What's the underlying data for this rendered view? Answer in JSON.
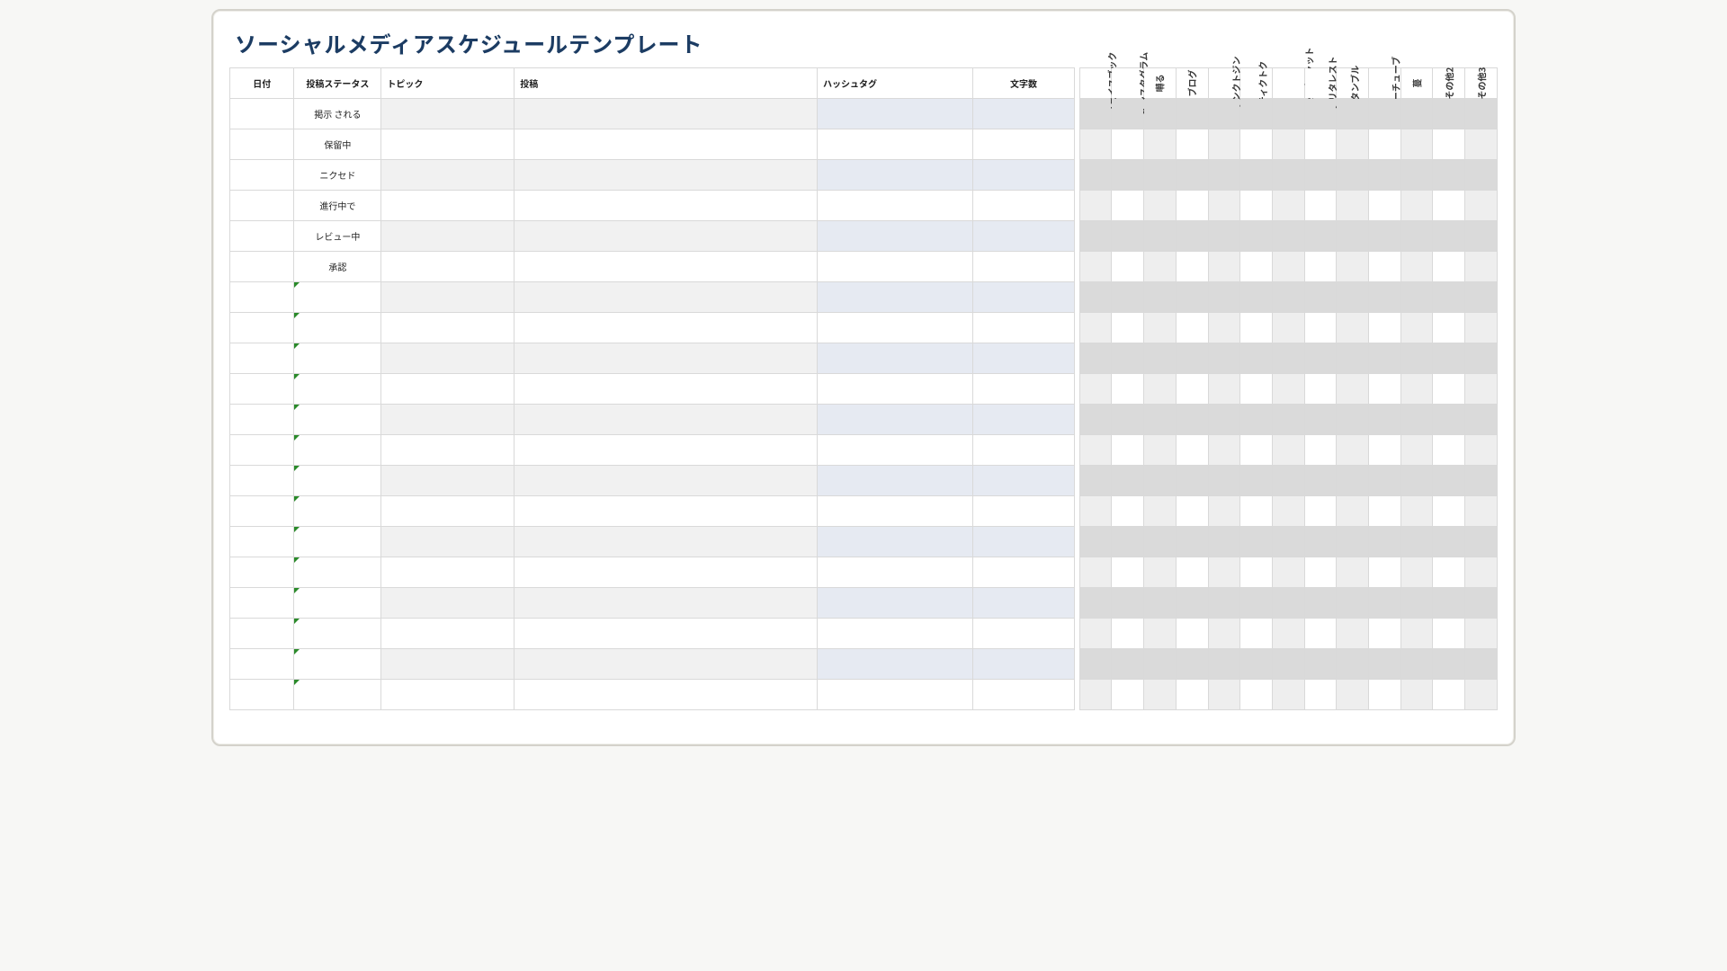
{
  "title": "ソーシャルメディアスケジュールテンプレート",
  "headers_main": {
    "date": "日付",
    "status": "投稿ステータス",
    "topic": "トピック",
    "post": "投稿",
    "hashtag": "ハッシュタグ",
    "chars": "文字数"
  },
  "platforms": [
    "フェイスブック",
    "インスタグラム",
    "囀る",
    "ブログ",
    "リンクトジン",
    "ティクトク",
    "スナップチャット",
    "プリタレスト",
    "タンブル",
    "ユーチューブ",
    "蔓",
    "その他2",
    "その他3"
  ],
  "rows": [
    {
      "status": "掲示 される",
      "band": "A",
      "marker": false
    },
    {
      "status": "保留中",
      "band": "B",
      "marker": false
    },
    {
      "status": "ニクセド",
      "band": "A",
      "marker": false
    },
    {
      "status": "進行中で",
      "band": "B",
      "marker": false
    },
    {
      "status": "レビュー中",
      "band": "A",
      "marker": false
    },
    {
      "status": "承認",
      "band": "B",
      "marker": false
    },
    {
      "status": "",
      "band": "A",
      "marker": true
    },
    {
      "status": "",
      "band": "B",
      "marker": true
    },
    {
      "status": "",
      "band": "A",
      "marker": true
    },
    {
      "status": "",
      "band": "B",
      "marker": true
    },
    {
      "status": "",
      "band": "A",
      "marker": true
    },
    {
      "status": "",
      "band": "B",
      "marker": true
    },
    {
      "status": "",
      "band": "A",
      "marker": true
    },
    {
      "status": "",
      "band": "B",
      "marker": true
    },
    {
      "status": "",
      "band": "A",
      "marker": true
    },
    {
      "status": "",
      "band": "B",
      "marker": true
    },
    {
      "status": "",
      "band": "A",
      "marker": true
    },
    {
      "status": "",
      "band": "B",
      "marker": true
    },
    {
      "status": "",
      "band": "A",
      "marker": true
    },
    {
      "status": "",
      "band": "B",
      "marker": true
    }
  ]
}
